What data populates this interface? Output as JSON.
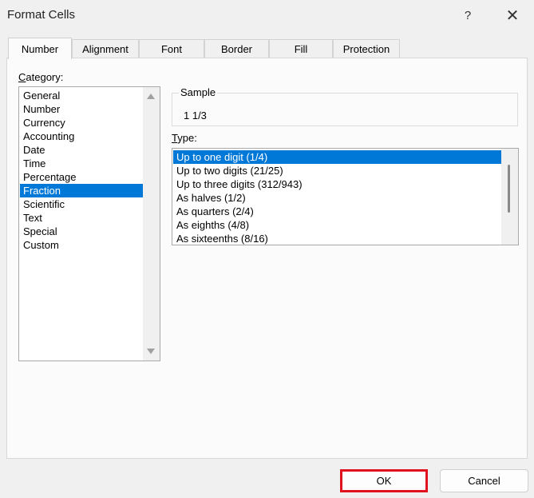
{
  "window": {
    "title": "Format Cells",
    "help_label": "?",
    "close_label": "✕"
  },
  "tabs": [
    {
      "label": "Number",
      "active": true
    },
    {
      "label": "Alignment",
      "active": false
    },
    {
      "label": "Font",
      "active": false
    },
    {
      "label": "Border",
      "active": false
    },
    {
      "label": "Fill",
      "active": false
    },
    {
      "label": "Protection",
      "active": false
    }
  ],
  "category": {
    "label": "Category:",
    "items": [
      "General",
      "Number",
      "Currency",
      "Accounting",
      "Date",
      "Time",
      "Percentage",
      "Fraction",
      "Scientific",
      "Text",
      "Special",
      "Custom"
    ],
    "selected": "Fraction"
  },
  "sample": {
    "label": "Sample",
    "value": "1 1/3"
  },
  "type": {
    "label": "Type:",
    "items": [
      "Up to one digit (1/4)",
      "Up to two digits (21/25)",
      "Up to three digits (312/943)",
      "As halves (1/2)",
      "As quarters (2/4)",
      "As eighths (4/8)",
      "As sixteenths (8/16)"
    ],
    "selected": "Up to one digit (1/4)"
  },
  "buttons": {
    "ok": "OK",
    "cancel": "Cancel"
  },
  "colors": {
    "selection": "#0078d7",
    "highlight_outline": "#e0121d"
  }
}
